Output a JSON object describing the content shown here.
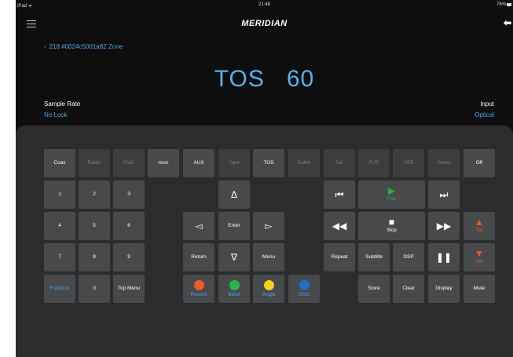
{
  "status_bar": {
    "device": "iPad ᯤ",
    "time": "21:48",
    "battery": "76%"
  },
  "header": {
    "logo": "MERIDIAN",
    "back_glyph": "⬅",
    "menu_icon": "hamburger-icon"
  },
  "zone": {
    "chevron": "‹",
    "label": "218 #0024c5001a82 Zone"
  },
  "display": {
    "source": "TOS",
    "volume": "60"
  },
  "info": {
    "sample_rate_label": "Sample Rate",
    "sample_rate_value": "No Lock",
    "input_label": "Input",
    "input_value": "Optical"
  },
  "colors": {
    "accent_blue": "#4da6e0",
    "display_blue": "#56b3ea",
    "play_green": "#28b040",
    "vol_orange": "#f05a22",
    "record_red": "#ee5a24",
    "band_green": "#2bb552",
    "angle_yellow": "#f3d11c",
    "osd_blue": "#1f6fc4"
  },
  "sources": [
    "Coax",
    "Radio",
    "DVD",
    "roon",
    "AUX",
    "Tape",
    "TOS",
    "Cable",
    "Sat",
    "PVR",
    "USB",
    "Game",
    "Off"
  ],
  "numpad": [
    "1",
    "2",
    "3",
    "4",
    "5",
    "6",
    "7",
    "8",
    "9",
    "Function",
    "0",
    "Top Menu"
  ],
  "nav": {
    "up": "Δ",
    "left": "◅",
    "enter": "Enter",
    "right": "▻",
    "return": "Return",
    "down": "∇",
    "menu": "Menu"
  },
  "transport": {
    "prev": "⏮",
    "play_glyph": "▶",
    "play": "Play",
    "next": "⏭",
    "rew": "◀◀",
    "stop_glyph": "■",
    "stop": "Stop",
    "ff": "▶▶",
    "vol_up_glyph": "▲",
    "vol_down_glyph": "▼",
    "vol": "Vol",
    "repeat": "Repeat",
    "subtitle": "Subtitle",
    "dsp": "DSP",
    "pause": "❚❚"
  },
  "color_buttons": {
    "record": "Record",
    "band": "Band",
    "angle": "Angle",
    "osd": "OSD"
  },
  "bottom_row": {
    "store": "Store",
    "clear": "Clear",
    "display": "Display",
    "mute": "Mute"
  }
}
